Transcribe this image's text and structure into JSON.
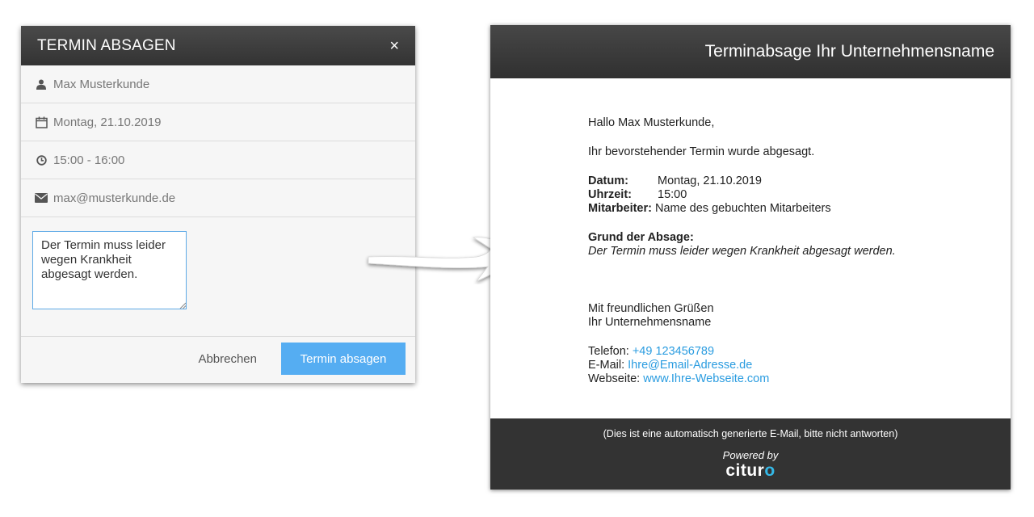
{
  "modal": {
    "title": "TERMIN ABSAGEN",
    "close_symbol": "×",
    "fields": {
      "name": {
        "icon": "user-icon",
        "value": "Max Musterkunde"
      },
      "date": {
        "icon": "calendar-icon",
        "value": "Montag, 21.10.2019"
      },
      "time": {
        "icon": "clock-icon",
        "value": "15:00 - 16:00"
      },
      "email": {
        "icon": "envelope-icon",
        "value": "max@musterkunde.de"
      }
    },
    "reason_value": "Der Termin muss leider wegen Krankheit abgesagt werden.",
    "cancel_label": "Abbrechen",
    "confirm_label": "Termin absagen"
  },
  "email": {
    "title": "Terminabsage Ihr Unternehmensname",
    "greeting": "Hallo Max Musterkunde,",
    "intro": "Ihr bevorstehender Termin wurde abgesagt.",
    "details": {
      "date_label": "Datum:",
      "date_value": "Montag, 21.10.2019",
      "time_label": "Uhrzeit:",
      "time_value": "15:00",
      "staff_label": "Mitarbeiter:",
      "staff_value": "Name des gebuchten Mitarbeiters"
    },
    "reason_label": "Grund der Absage:",
    "reason_text": "Der Termin muss leider wegen Krankheit abgesagt werden.",
    "closing": "Mit freundlichen Grüßen",
    "company": "Ihr Unternehmensname",
    "phone_label": "Telefon:",
    "phone_value": "+49 123456789",
    "email_label": "E-Mail:",
    "email_value": "Ihre@Email-Adresse.de",
    "web_label": "Webseite:",
    "web_value": "www.Ihre-Webseite.com",
    "footer_note": "(Dies ist eine automatisch generierte E-Mail, bitte nicht antworten)",
    "powered_by": "Powered by",
    "brand_main": "citur",
    "brand_accent": "o"
  },
  "colors": {
    "primary_button": "#55adf2",
    "link": "#2a9ce0",
    "header_dark": "#333333",
    "brand_accent": "#34b9e8"
  }
}
